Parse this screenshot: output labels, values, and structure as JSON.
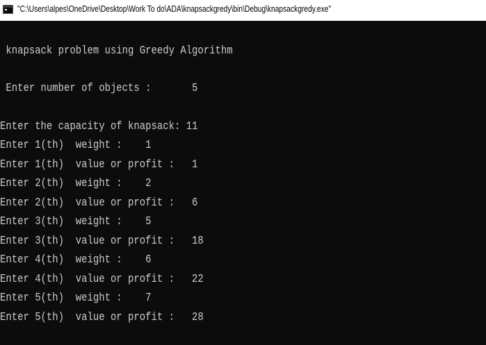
{
  "window": {
    "title": "\"C:\\Users\\alpes\\OneDrive\\Desktop\\Work To do\\ADA\\knapsackgredy\\bin\\Debug\\knapsackgredy.exe\"",
    "icon": "console-app-icon",
    "background_color": "#0c0c0c",
    "text_color": "#cccccc"
  },
  "console": {
    "lines": [
      " knapsack problem using Greedy Algorithm",
      " Enter number of objects :       5",
      "Enter the capacity of knapsack: 11",
      "Enter 1(th)  weight :    1",
      "Enter 1(th)  value or profit :   1",
      "Enter 2(th)  weight :    2",
      "Enter 2(th)  value or profit :   6",
      "Enter 3(th)  weight :    5",
      "Enter 3(th)  value or profit :   18",
      "Enter 4(th)  weight :    6",
      "Enter 4(th)  value or profit :   22",
      "Enter 5(th)  weight :    7",
      "Enter 5(th)  value or profit :   28"
    ]
  }
}
